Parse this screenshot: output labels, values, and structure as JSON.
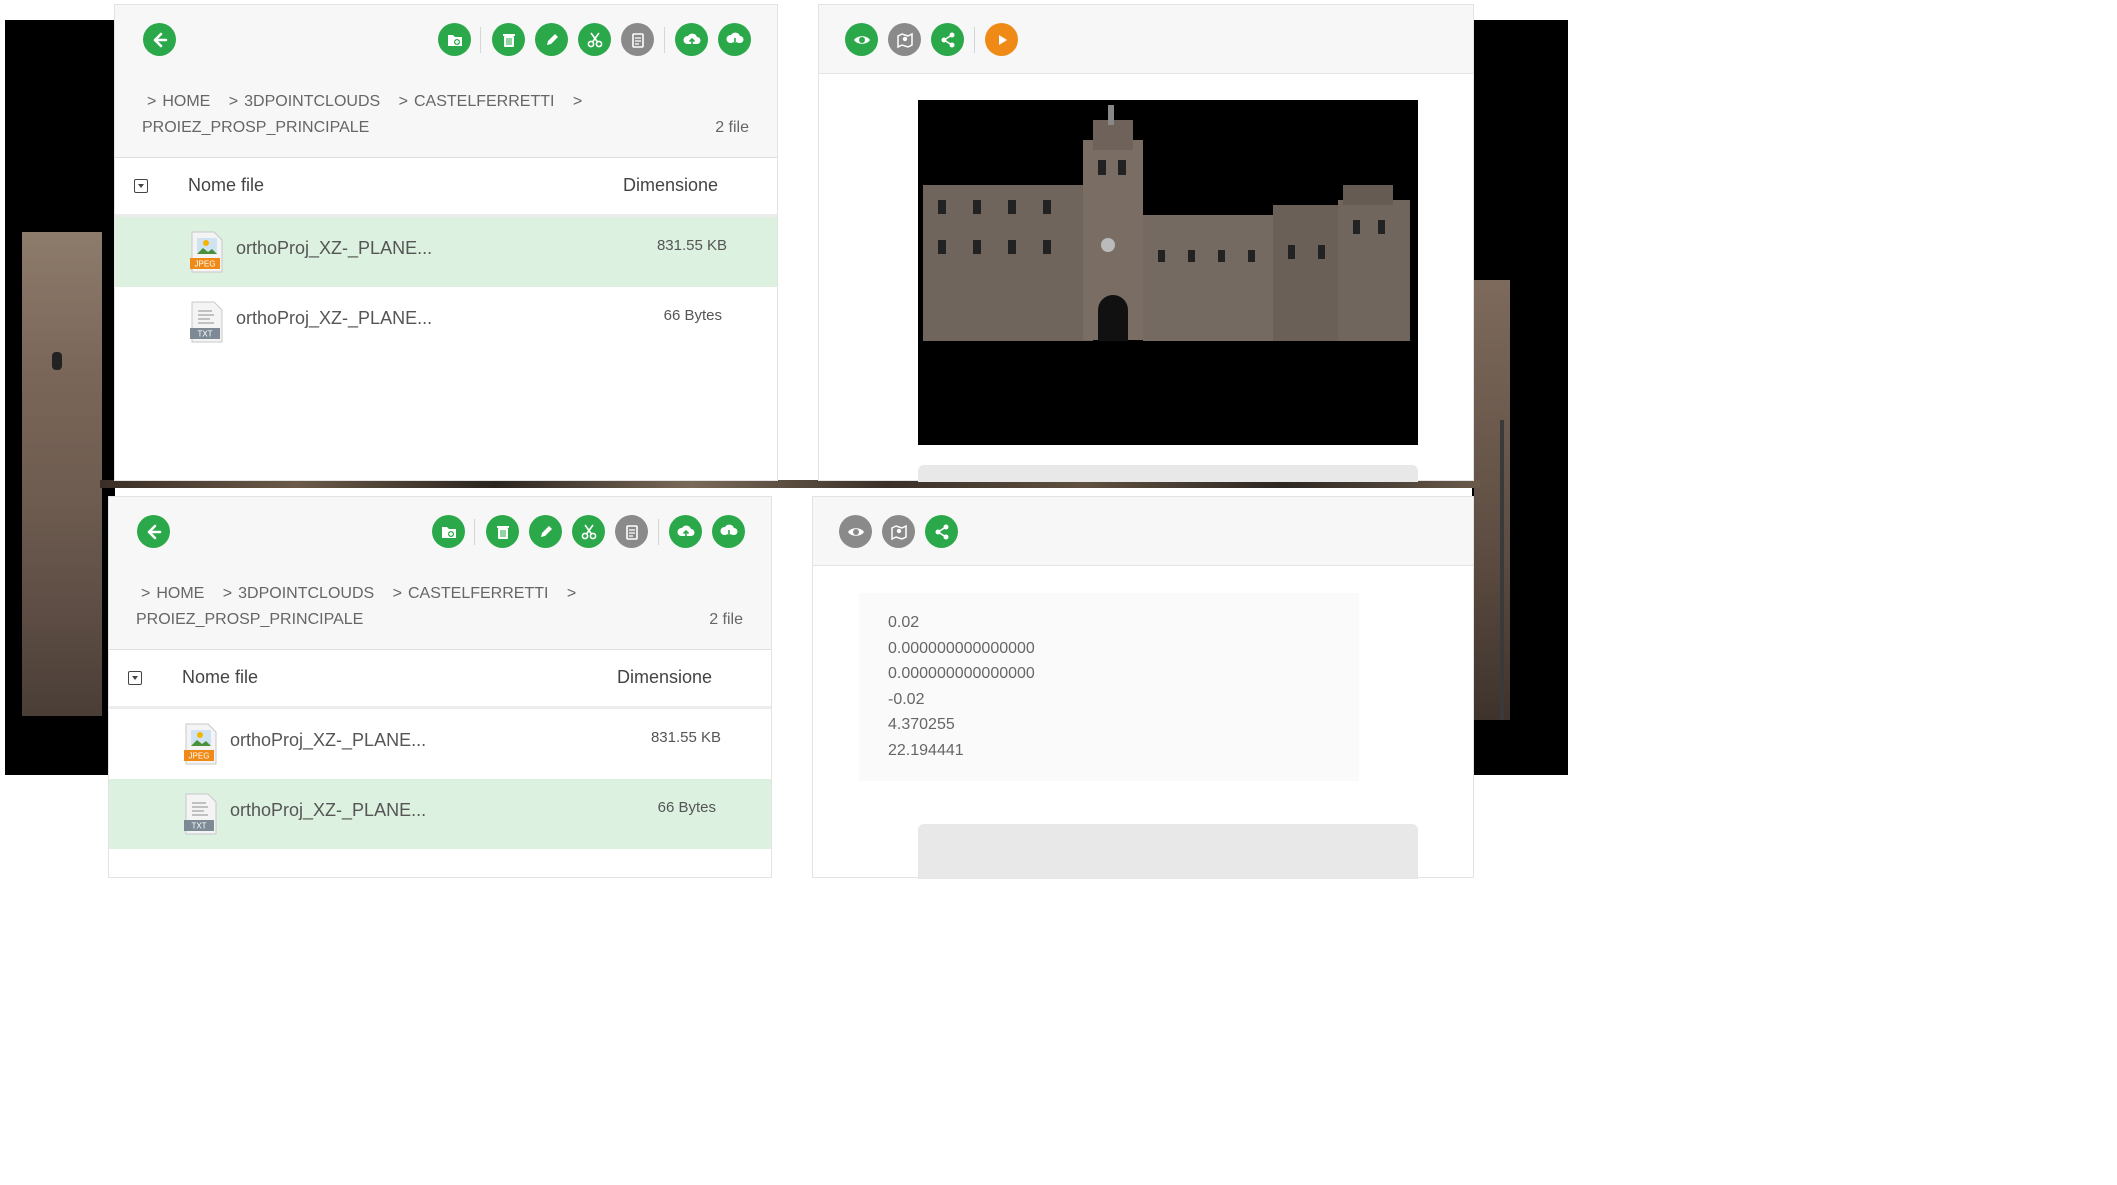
{
  "colors": {
    "accent_green": "#2aa84a",
    "icon_gray": "#8a8a8a",
    "play_orange": "#f08a17",
    "selected_row": "#dcf1e0"
  },
  "toolbar": {
    "icons": [
      "back-icon",
      "new-folder-icon",
      "trash-icon",
      "edit-icon",
      "cut-icon",
      "paste-icon",
      "upload-icon",
      "download-icon"
    ]
  },
  "preview_toolbar": {
    "icons": [
      "eye-icon",
      "map-icon",
      "share-icon",
      "play-icon"
    ]
  },
  "breadcrumb": {
    "sep": ">",
    "home": "HOME",
    "level1": "3DPOINTCLOUDS",
    "level2": "CASTELFERRETTI",
    "level3": "PROIEZ_PROSP_PRINCIPALE",
    "count": "2 file"
  },
  "table": {
    "col_name": "Nome file",
    "col_size": "Dimensione",
    "rows": [
      {
        "name": "orthoProj_XZ-_PLANE...",
        "size": "831.55 KB",
        "type": "JPEG"
      },
      {
        "name": "orthoProj_XZ-_PLANE...",
        "size": "66 Bytes",
        "type": "TXT"
      }
    ]
  },
  "txt_preview": {
    "lines": [
      "0.02",
      "0.000000000000000",
      "0.000000000000000",
      "-0.02",
      "4.370255",
      "22.194441"
    ]
  },
  "panels": {
    "top": {
      "selected_row": 0
    },
    "bottom": {
      "selected_row": 1
    }
  }
}
